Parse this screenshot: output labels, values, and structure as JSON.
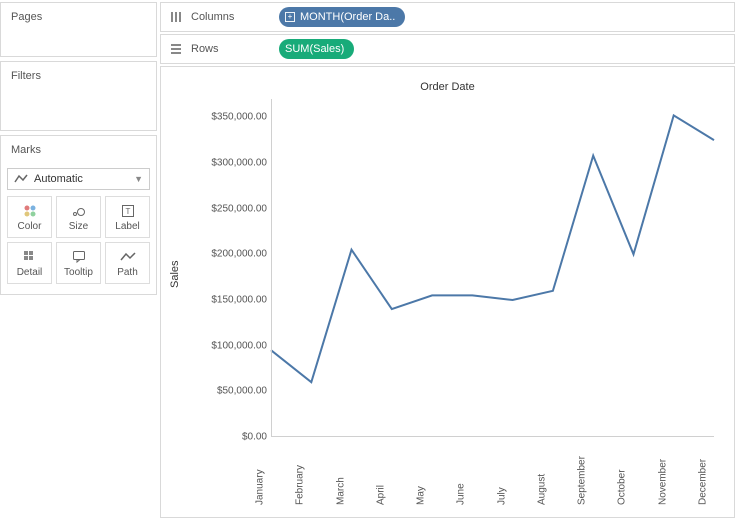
{
  "sidebar": {
    "pages_label": "Pages",
    "filters_label": "Filters",
    "marks_label": "Marks",
    "mark_type": "Automatic",
    "mark_buttons": [
      {
        "id": "color",
        "label": "Color"
      },
      {
        "id": "size",
        "label": "Size"
      },
      {
        "id": "label",
        "label": "Label"
      },
      {
        "id": "detail",
        "label": "Detail"
      },
      {
        "id": "tooltip",
        "label": "Tooltip"
      },
      {
        "id": "path",
        "label": "Path"
      }
    ]
  },
  "shelves": {
    "columns_label": "Columns",
    "rows_label": "Rows",
    "columns_pill": "MONTH(Order Da..",
    "rows_pill": "SUM(Sales)"
  },
  "chart_data": {
    "type": "line",
    "title": "Order Date",
    "xlabel": "",
    "ylabel": "Sales",
    "ylim": [
      0,
      370000
    ],
    "ytick_values": [
      0,
      50000,
      100000,
      150000,
      200000,
      250000,
      300000,
      350000
    ],
    "ytick_labels": [
      "$0.00",
      "$50,000.00",
      "$100,000.00",
      "$150,000.00",
      "$200,000.00",
      "$250,000.00",
      "$300,000.00",
      "$350,000.00"
    ],
    "categories": [
      "January",
      "February",
      "March",
      "April",
      "May",
      "June",
      "July",
      "August",
      "September",
      "October",
      "November",
      "December"
    ],
    "values": [
      95000,
      60000,
      205000,
      140000,
      155000,
      155000,
      150000,
      160000,
      308000,
      200000,
      352000,
      325000
    ],
    "line_color": "#4c78a8"
  }
}
